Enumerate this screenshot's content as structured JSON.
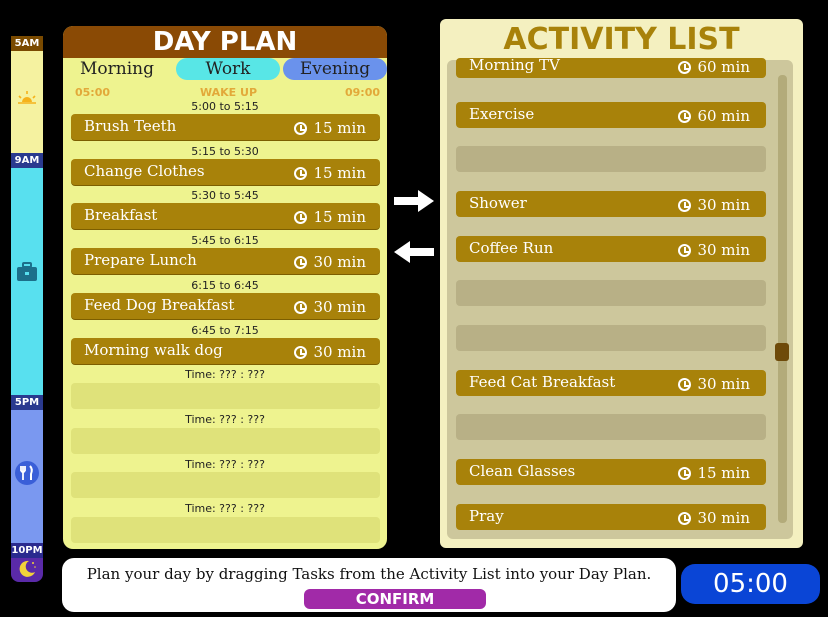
{
  "timeline": {
    "labels": [
      "5AM",
      "9AM",
      "5PM",
      "10PM"
    ],
    "icons": [
      "sun-icon",
      "briefcase-icon",
      "utensils-icon",
      "moon-icon"
    ]
  },
  "day_plan": {
    "title": "DAY PLAN",
    "tabs": [
      "Morning",
      "Work",
      "Evening"
    ],
    "range": {
      "start": "05:00",
      "label": "WAKE UP",
      "end": "09:00"
    },
    "tasks": [
      {
        "time": "5:00 to 5:15",
        "name": "Brush Teeth",
        "duration": "15 min"
      },
      {
        "time": "5:15 to 5:30",
        "name": "Change Clothes",
        "duration": "15 min"
      },
      {
        "time": "5:30 to 5:45",
        "name": "Breakfast",
        "duration": "15 min"
      },
      {
        "time": "5:45 to 6:15",
        "name": "Prepare Lunch",
        "duration": "30 min"
      },
      {
        "time": "6:15 to 6:45",
        "name": "Feed Dog Breakfast",
        "duration": "30 min"
      },
      {
        "time": "6:45 to 7:15",
        "name": "Morning walk dog",
        "duration": "30 min"
      }
    ],
    "empty_slots": [
      "Time: ??? : ???",
      "Time: ??? : ???",
      "Time: ??? : ???",
      "Time: ??? : ???"
    ]
  },
  "activity_list": {
    "title": "ACTIVITY LIST",
    "items": [
      {
        "name": "Morning TV",
        "duration": "60 min"
      },
      {
        "name": "Exercise",
        "duration": "60 min"
      },
      {
        "name": "",
        "duration": ""
      },
      {
        "name": "Shower",
        "duration": "30 min"
      },
      {
        "name": "Coffee Run",
        "duration": "30 min"
      },
      {
        "name": "",
        "duration": ""
      },
      {
        "name": "",
        "duration": ""
      },
      {
        "name": "Feed Cat Breakfast",
        "duration": "30 min"
      },
      {
        "name": "",
        "duration": ""
      },
      {
        "name": "Clean Glasses",
        "duration": "15 min"
      },
      {
        "name": "Pray",
        "duration": "30 min"
      }
    ]
  },
  "footer": {
    "message": "Plan your day by dragging Tasks from the Activity List into your Day Plan.",
    "confirm_label": "CONFIRM",
    "clock": "05:00"
  },
  "colors": {
    "accent": "#a8820a",
    "panel": "#eef38f",
    "confirm": "#a12aa8",
    "clock": "#0a45d6"
  }
}
